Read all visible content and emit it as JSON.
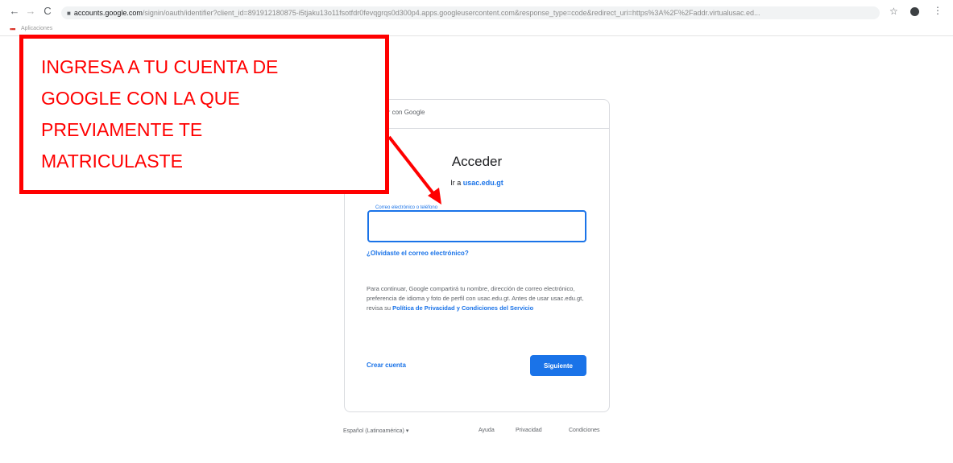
{
  "browser": {
    "back_icon": "←",
    "forward_icon": "→",
    "reload_icon": "C",
    "url_host": "accounts.google.com",
    "url_rest": "/signin/oauth/identifier?client_id=891912180875-i5tjaku13o11fsotfdr0fevqgrqs0d300p4.apps.googleusercontent.com&response_type=code&redirect_uri=https%3A%2F%2Faddr.virtualusac.ed...",
    "star_icon": "☆",
    "menu_icon": "⋮",
    "apps_label": "Aplicaciones"
  },
  "card": {
    "head_label": "Acceder con Google",
    "title": "Acceder",
    "subtitle_prefix": "Ir a",
    "subtitle_link": "usac.edu.gt",
    "email_label": "Correo electrónico o teléfono",
    "email_value": "",
    "forgot_link": "¿Olvidaste el correo electrónico?",
    "privacy_text": "Para continuar, Google compartirá tu nombre, dirección de correo electrónico, preferencia de idioma y foto de perfil con usac.edu.gt. Antes de usar usac.edu.gt, revisa su",
    "privacy_link": "Política de Privacidad y Condiciones del Servicio",
    "create_account": "Crear cuenta",
    "next_button": "Siguiente"
  },
  "footer": {
    "language": "Español (Latinoamérica) ▾",
    "help": "Ayuda",
    "privacy": "Privacidad",
    "terms": "Condiciones"
  },
  "callout": {
    "text": "INGRESA A TU CUENTA DE GOOGLE CON LA QUE PREVIAMENTE TE MATRICULASTE"
  },
  "colors": {
    "annotation": "#ff0000",
    "google_blue": "#1a73e8"
  }
}
